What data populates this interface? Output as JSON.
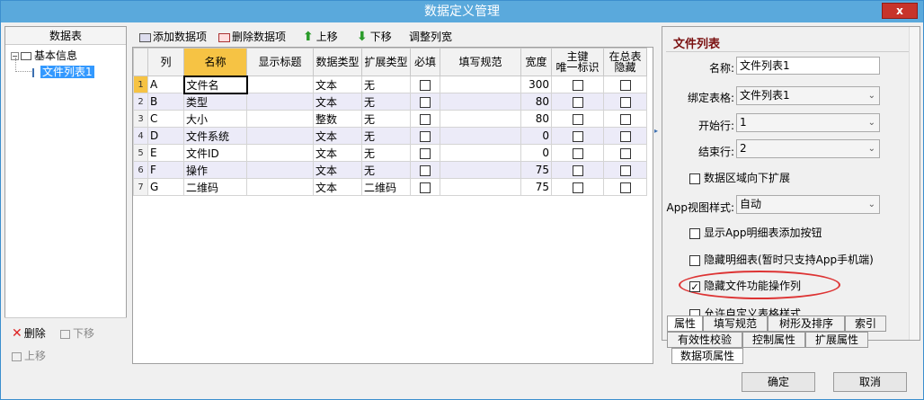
{
  "window": {
    "title": "数据定义管理",
    "close_label": "x"
  },
  "left": {
    "header": "数据表",
    "tree_toggle": "−",
    "root_label": "基本信息",
    "child_label": "文件列表1",
    "delete_label": "删除",
    "down_label": "下移",
    "up_label": "上移"
  },
  "toolbar": {
    "add_label": "添加数据项",
    "delete_label": "删除数据项",
    "up_label": "上移",
    "down_label": "下移",
    "adjust_label": "调整列宽"
  },
  "grid": {
    "headers": [
      "",
      "列",
      "名称",
      "显示标题",
      "数据类型",
      "扩展类型",
      "必填",
      "填写规范",
      "宽度",
      "主键\n唯一标识",
      "在总表\n隐藏"
    ],
    "rows": [
      {
        "n": "1",
        "col": "A",
        "name": "文件名",
        "title": "",
        "dtype": "文本",
        "ext": "无",
        "rule": "",
        "width": "300"
      },
      {
        "n": "2",
        "col": "B",
        "name": "类型",
        "title": "",
        "dtype": "文本",
        "ext": "无",
        "rule": "",
        "width": "80"
      },
      {
        "n": "3",
        "col": "C",
        "name": "大小",
        "title": "",
        "dtype": "整数",
        "ext": "无",
        "rule": "",
        "width": "80"
      },
      {
        "n": "4",
        "col": "D",
        "name": "文件系统",
        "title": "",
        "dtype": "文本",
        "ext": "无",
        "rule": "",
        "width": "0"
      },
      {
        "n": "5",
        "col": "E",
        "name": "文件ID",
        "title": "",
        "dtype": "文本",
        "ext": "无",
        "rule": "",
        "width": "0"
      },
      {
        "n": "6",
        "col": "F",
        "name": "操作",
        "title": "",
        "dtype": "文本",
        "ext": "无",
        "rule": "",
        "width": "75"
      },
      {
        "n": "7",
        "col": "G",
        "name": "二维码",
        "title": "",
        "dtype": "文本",
        "ext": "二维码",
        "rule": "",
        "width": "75"
      }
    ]
  },
  "props": {
    "title": "文件列表",
    "name_label": "名称:",
    "name_value": "文件列表1",
    "bind_label": "绑定表格:",
    "bind_value": "文件列表1",
    "start_label": "开始行:",
    "start_value": "1",
    "end_label": "结束行:",
    "end_value": "2",
    "expand_label": "数据区域向下扩展",
    "app_style_label": "App视图样式:",
    "app_style_value": "自动",
    "show_add_label": "显示App明细表添加按钮",
    "hide_detail_label": "隐藏明细表(暂时只支持App手机端)",
    "hide_file_ops_label": "隐藏文件功能操作列",
    "custom_style_label": "允许自定义表格样式"
  },
  "tabs": {
    "row1": [
      "属性",
      "填写规范",
      "树形及排序",
      "索引"
    ],
    "row2": [
      "有效性校验",
      "控制属性",
      "扩展属性"
    ],
    "row3": [
      "数据项属性"
    ]
  },
  "buttons": {
    "ok": "确定",
    "cancel": "取消"
  }
}
